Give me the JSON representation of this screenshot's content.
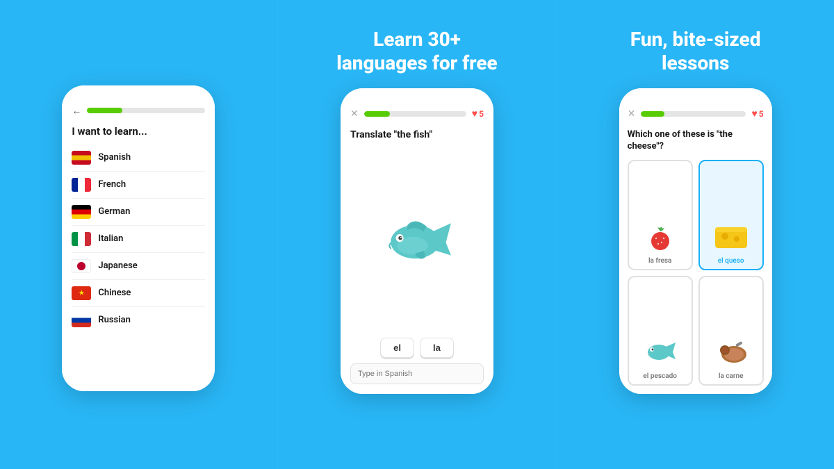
{
  "panels": {
    "left": {
      "headline": null,
      "phone": {
        "header": {
          "back_label": "←",
          "progress_pct": 30
        },
        "title": "I want to learn...",
        "languages": [
          {
            "name": "Spanish",
            "flag": "spanish"
          },
          {
            "name": "French",
            "flag": "french"
          },
          {
            "name": "German",
            "flag": "german"
          },
          {
            "name": "Italian",
            "flag": "italian"
          },
          {
            "name": "Japanese",
            "flag": "japanese"
          },
          {
            "name": "Chinese",
            "flag": "chinese"
          },
          {
            "name": "Russian",
            "flag": "russian"
          }
        ]
      }
    },
    "center": {
      "headline": "Learn 30+\nlanguages for free",
      "phone": {
        "x_label": "✕",
        "hearts": "5",
        "question": "Translate \"the fish\"",
        "word_buttons": [
          "el",
          "la"
        ],
        "input_placeholder": "Type in Spanish"
      }
    },
    "right": {
      "headline": "Fun, bite-sized\nlessons",
      "phone": {
        "x_label": "✕",
        "hearts": "5",
        "question": "Which one of these is \"the cheese\"?",
        "cards": [
          {
            "label": "la fresa",
            "type": "strawberry",
            "selected": false
          },
          {
            "label": "el queso",
            "type": "cheese",
            "selected": true
          },
          {
            "label": "el pescado",
            "type": "fish",
            "selected": false
          },
          {
            "label": "la carne",
            "type": "meat",
            "selected": false
          }
        ]
      }
    }
  }
}
